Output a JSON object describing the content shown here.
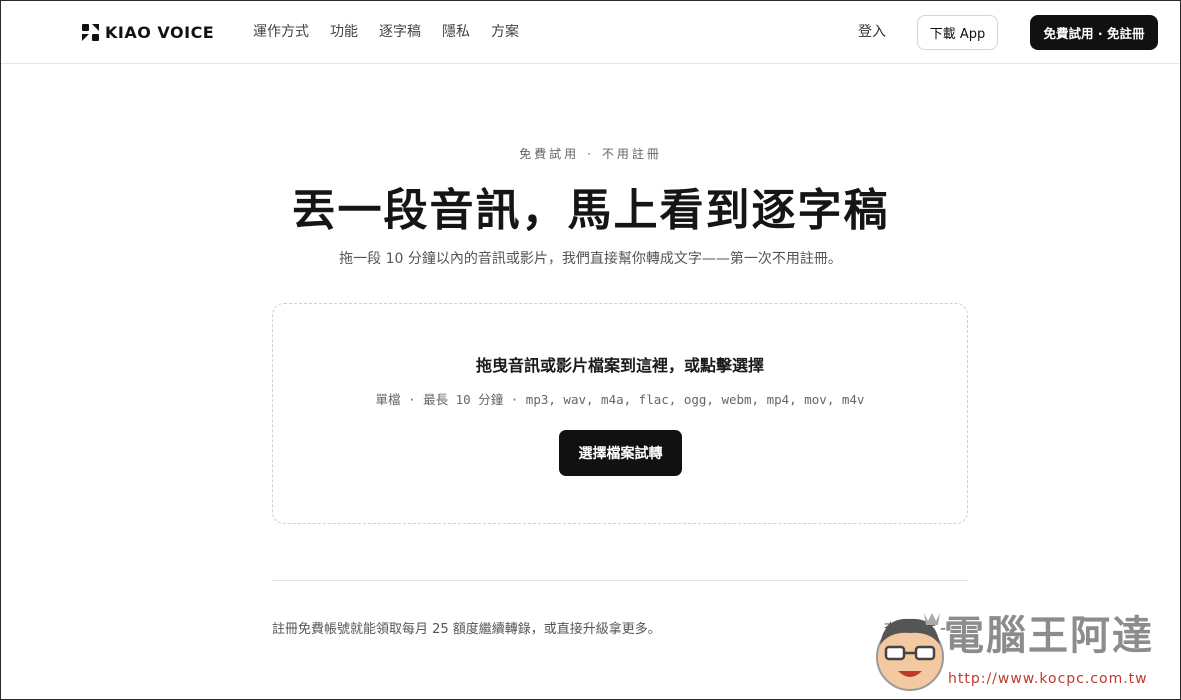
{
  "header": {
    "brand": "KIAO VOICE",
    "nav": [
      {
        "label": "運作方式"
      },
      {
        "label": "功能"
      },
      {
        "label": "逐字稿"
      },
      {
        "label": "隱私"
      },
      {
        "label": "方案"
      }
    ],
    "login_label": "登入",
    "download_label": "下載 App",
    "trial_label": "免費試用 · 免註冊"
  },
  "hero": {
    "eyebrow_left": "免費試用",
    "eyebrow_sep": "·",
    "eyebrow_right": "不用註冊",
    "title": "丟一段音訊，馬上看到逐字稿",
    "subtitle": "拖一段 10 分鐘以內的音訊或影片，我們直接幫你轉成文字——第一次不用註冊。"
  },
  "dropzone": {
    "title": "拖曳音訊或影片檔案到這裡，或點擊選擇",
    "meta": "單檔 · 最長 10 分鐘 · mp3, wav, m4a, flac, ogg, webm, mp4, mov, m4v",
    "button_label": "選擇檔案試轉"
  },
  "footer": {
    "note": "註冊免費帳號就能領取每月 25 額度繼續轉錄，或直接升級拿更多。",
    "plans_link": "查看方案 →"
  },
  "watermark": {
    "text": "電腦王阿達",
    "url": "http://www.kocpc.com.tw"
  },
  "colors": {
    "primary": "#111111",
    "border": "#e6e6e6",
    "dashed_border": "#cfcfcf",
    "text_muted": "#555555"
  },
  "icons": {
    "logo": "kiao-logo-mark-icon"
  }
}
